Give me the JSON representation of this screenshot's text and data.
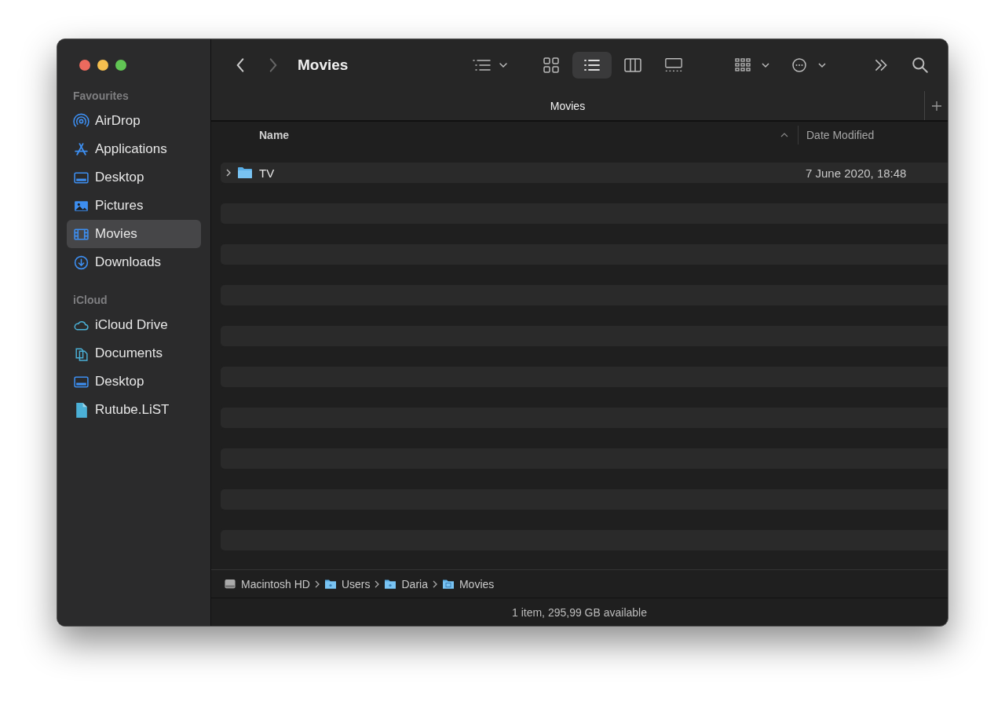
{
  "window": {
    "title": "Movies"
  },
  "toolbar": {
    "view_modes": [
      {
        "kind": "icons",
        "selected": false
      },
      {
        "kind": "list",
        "selected": true
      },
      {
        "kind": "columns",
        "selected": false
      },
      {
        "kind": "gallery",
        "selected": false
      }
    ]
  },
  "sidebar": {
    "sections": [
      {
        "title": "Favourites",
        "items": [
          {
            "label": "AirDrop",
            "kind": "airdrop",
            "selected": false
          },
          {
            "label": "Applications",
            "kind": "apps",
            "selected": false
          },
          {
            "label": "Desktop",
            "kind": "desktop",
            "selected": false
          },
          {
            "label": "Pictures",
            "kind": "pictures",
            "selected": false
          },
          {
            "label": "Movies",
            "kind": "movies",
            "selected": true
          },
          {
            "label": "Downloads",
            "kind": "downloads",
            "selected": false
          }
        ]
      },
      {
        "title": "iCloud",
        "items": [
          {
            "label": "iCloud Drive",
            "kind": "cloud",
            "selected": false
          },
          {
            "label": "Documents",
            "kind": "documents",
            "selected": false
          },
          {
            "label": "Desktop",
            "kind": "desktop",
            "selected": false
          },
          {
            "label": "Rutube.LiST",
            "kind": "file",
            "selected": false
          }
        ]
      }
    ]
  },
  "tabs": [
    {
      "label": "Movies",
      "selected": true
    }
  ],
  "table": {
    "columns": [
      "Name",
      "Date Modified"
    ],
    "rows": [
      {
        "name": "TV",
        "date": "7 June 2020, 18:48",
        "expanded": false
      }
    ]
  },
  "path_bar": [
    {
      "label": "Macintosh HD",
      "kind": "disk"
    },
    {
      "label": "Users",
      "kind": "folder"
    },
    {
      "label": "Daria",
      "kind": "folder"
    },
    {
      "label": "Movies",
      "kind": "movies-folder"
    }
  ],
  "status_bar": "1 item, 295,99 GB available"
}
